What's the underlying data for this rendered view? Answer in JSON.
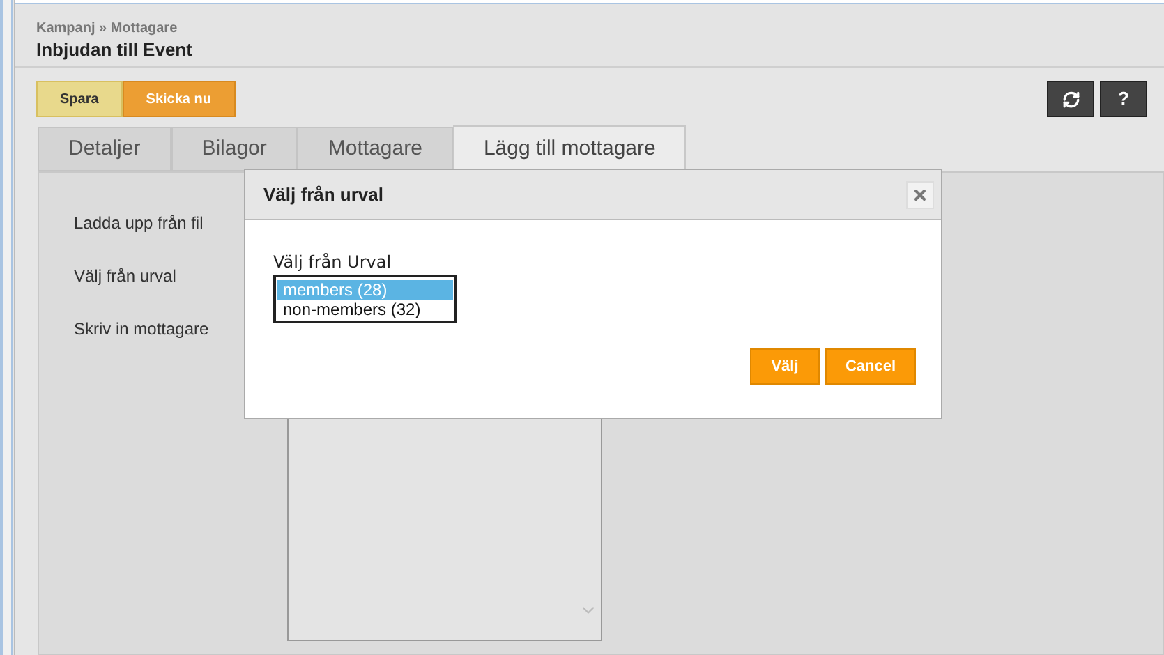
{
  "breadcrumb": "Kampanj » Mottagare",
  "title": "Inbjudan till Event",
  "toolbar": {
    "buttons": [
      {
        "label": "Spara",
        "kind": "save"
      },
      {
        "label": "Skicka nu",
        "kind": "send"
      }
    ],
    "help": "?"
  },
  "tabs": [
    {
      "label": "Detaljer",
      "selected": false
    },
    {
      "label": "Bilagor",
      "selected": false
    },
    {
      "label": "Mottagare",
      "selected": false
    },
    {
      "label": "Lägg till mottagare",
      "selected": true
    }
  ],
  "options": [
    "Ladda upp från fil",
    "Välj från urval",
    "Skriv in mottagare"
  ],
  "dialog": {
    "title": "Välj från urval",
    "label": "Välj från Urval",
    "items": [
      {
        "label": "members (28)",
        "selected": true
      },
      {
        "label": "non-members (32)",
        "selected": false
      }
    ],
    "buttons": [
      "Välj",
      "Cancel"
    ]
  }
}
